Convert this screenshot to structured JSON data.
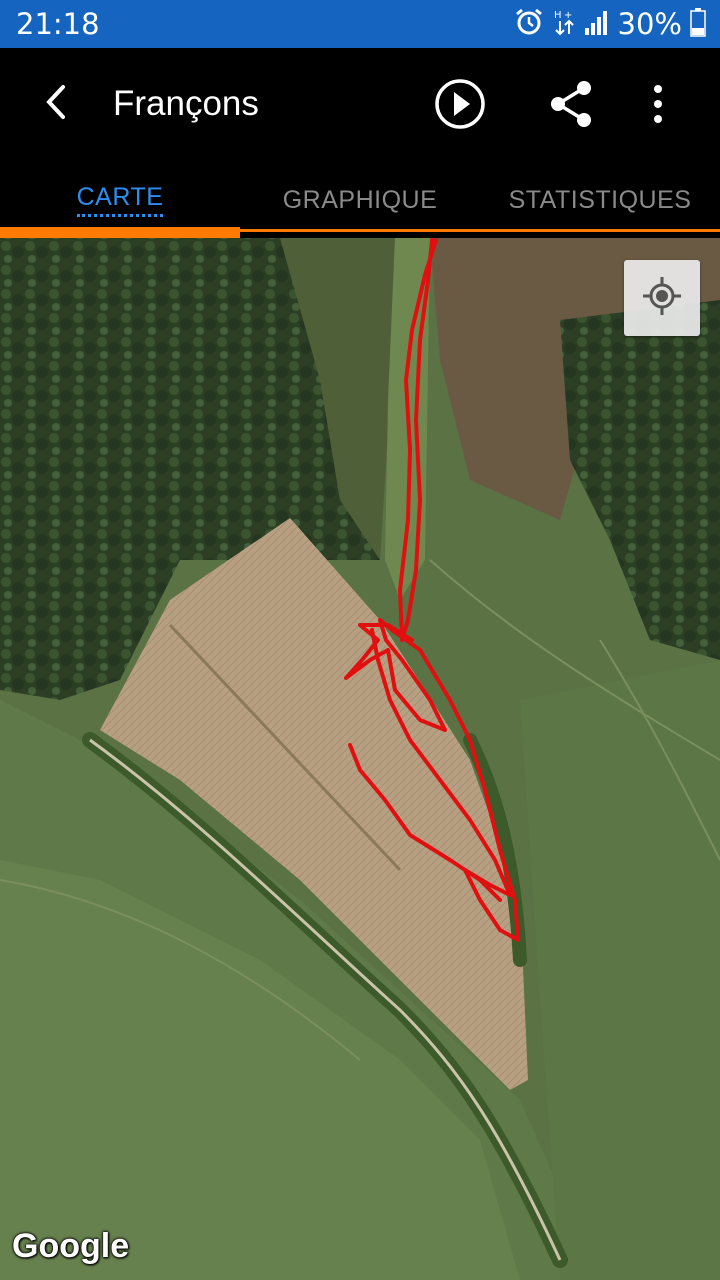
{
  "status_bar": {
    "time": "21:18",
    "battery_percent": "30%",
    "icons": [
      "alarm-icon",
      "data-arrows-icon",
      "signal-icon",
      "battery-icon"
    ],
    "battery_level": 0.3
  },
  "app_bar": {
    "title": "Françons",
    "icons": {
      "back": "back-arrow-icon",
      "play": "play-circle-icon",
      "share": "share-icon",
      "more": "more-vert-icon"
    }
  },
  "tabs": [
    {
      "label": "CARTE",
      "active": true
    },
    {
      "label": "GRAPHIQUE",
      "active": false
    },
    {
      "label": "STATISTIQUES",
      "active": false
    }
  ],
  "map": {
    "provider_label": "Google",
    "locate_icon": "my-location-icon",
    "track_color": "#e01010"
  },
  "colors": {
    "status_bar_bg": "#1565c0",
    "active_tab": "#2d8ef0",
    "tab_indicator": "#ff7a00",
    "inactive_tab": "#8a8a8a"
  }
}
